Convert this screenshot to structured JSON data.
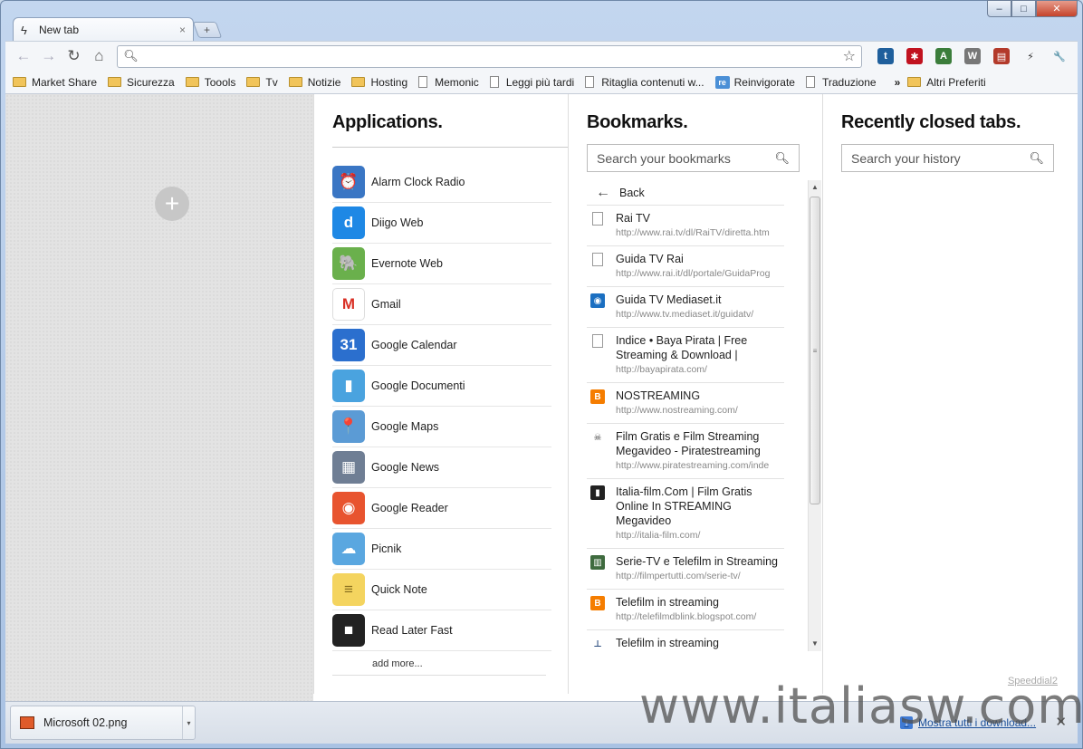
{
  "window": {
    "min": "–",
    "max": "□",
    "close": "✕"
  },
  "tab": {
    "title": "New tab",
    "close": "×",
    "new_tab": "+"
  },
  "toolbar": {
    "back": "←",
    "forward": "→",
    "reload": "↻",
    "home": "⌂",
    "omnibox_value": "",
    "star": "☆"
  },
  "extensions": [
    {
      "name": "twitter-extension-icon",
      "glyph": "t",
      "color": "#1f5f9c"
    },
    {
      "name": "lastpass-extension-icon",
      "glyph": "✱",
      "color": "#c1121f"
    },
    {
      "name": "translate-extension-icon",
      "glyph": "A",
      "color": "#3b7d3b"
    },
    {
      "name": "wikipedia-extension-icon",
      "glyph": "W",
      "color": "#777777"
    },
    {
      "name": "clipboard-extension-icon",
      "glyph": "▤",
      "color": "#b33a2b"
    },
    {
      "name": "lightning-extension-icon",
      "glyph": "⚡",
      "color": "#333333"
    },
    {
      "name": "wrench-icon",
      "glyph": "🔧",
      "color": "#444444"
    }
  ],
  "bookmarks_bar": {
    "items": [
      {
        "label": "Market Share",
        "type": "folder"
      },
      {
        "label": "Sicurezza",
        "type": "folder"
      },
      {
        "label": "Toools",
        "type": "folder"
      },
      {
        "label": "Tv",
        "type": "folder"
      },
      {
        "label": "Notizie",
        "type": "folder"
      },
      {
        "label": "Hosting",
        "type": "folder"
      },
      {
        "label": "Memonic",
        "type": "page"
      },
      {
        "label": "Leggi più tardi",
        "type": "page"
      },
      {
        "label": "Ritaglia contenuti w...",
        "type": "page"
      },
      {
        "label": "Reinvigorate",
        "type": "re"
      },
      {
        "label": "Traduzione",
        "type": "page"
      }
    ],
    "overflow": "»",
    "other": "Altri Preferiti"
  },
  "applications": {
    "title": "Applications.",
    "items": [
      {
        "name": "Alarm Clock Radio",
        "glyph": "⏰",
        "color": "#3a76c4"
      },
      {
        "name": "Diigo Web",
        "glyph": "d",
        "color": "#1e88e5"
      },
      {
        "name": "Evernote Web",
        "glyph": "🐘",
        "color": "#6ab04c"
      },
      {
        "name": "Gmail",
        "glyph": "M",
        "color": "#d93025"
      },
      {
        "name": "Google Calendar",
        "glyph": "31",
        "color": "#2b6fce"
      },
      {
        "name": "Google Documenti",
        "glyph": "▮",
        "color": "#4aa3df"
      },
      {
        "name": "Google Maps",
        "glyph": "📍",
        "color": "#5b9bd5"
      },
      {
        "name": "Google News",
        "glyph": "▦",
        "color": "#6f7e94"
      },
      {
        "name": "Google Reader",
        "glyph": "◉",
        "color": "#e8542f"
      },
      {
        "name": "Picnik",
        "glyph": "☁",
        "color": "#5aa7e0"
      },
      {
        "name": "Quick Note",
        "glyph": "≡",
        "color": "#f4d45f"
      },
      {
        "name": "Read Later Fast",
        "glyph": "■",
        "color": "#222222"
      }
    ],
    "add_more": "add more..."
  },
  "bookmarks": {
    "title": "Bookmarks.",
    "search_placeholder": "Search your bookmarks",
    "back": "Back",
    "items": [
      {
        "title": "Rai TV",
        "url": "http://www.rai.tv/dl/RaiTV/diretta.htm",
        "icon": "page"
      },
      {
        "title": "Guida TV Rai",
        "url": "http://www.rai.it/dl/portale/GuidaProg",
        "icon": "page"
      },
      {
        "title": "Guida TV Mediaset.it",
        "url": "http://www.tv.mediaset.it/guidatv/",
        "icon": "mediaset"
      },
      {
        "title": "Indice • Baya Pirata | Free Streaming & Download |",
        "url": "http://bayapirata.com/",
        "icon": "page"
      },
      {
        "title": "NOSTREAMING",
        "url": "http://www.nostreaming.com/",
        "icon": "blogger"
      },
      {
        "title": "Film Gratis e Film Streaming Megavideo - Piratestreaming",
        "url": "http://www.piratestreaming.com/inde",
        "icon": "pirate"
      },
      {
        "title": "Italia-film.Com | Film Gratis Online In STREAMING Megavideo",
        "url": "http://italia-film.com/",
        "icon": "film"
      },
      {
        "title": "Serie-TV e Telefilm in Streaming",
        "url": "http://filmpertutti.com/serie-tv/",
        "icon": "filmstrip"
      },
      {
        "title": "Telefilm in streaming",
        "url": "http://telefilmdblink.blogspot.com/",
        "icon": "blogger"
      },
      {
        "title": "Telefilm in streaming",
        "url": "",
        "icon": "stamp"
      }
    ]
  },
  "recent": {
    "title": "Recently closed tabs.",
    "search_placeholder": "Search your history"
  },
  "footer_link": "Speeddial2",
  "download_shelf": {
    "file": "Microsoft 02.png",
    "show_all": "Mostra tutti i download...",
    "close": "✕"
  },
  "watermark": "www.italiasw.com"
}
